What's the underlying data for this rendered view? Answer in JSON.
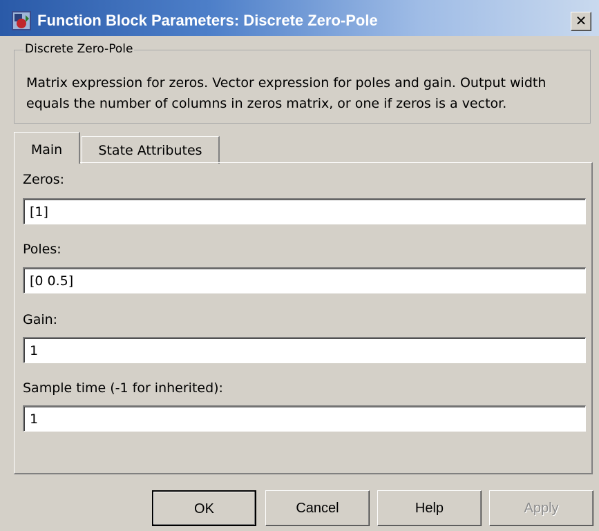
{
  "window": {
    "title": "Function Block Parameters: Discrete Zero-Pole",
    "icon": "simulink-block-icon",
    "close_glyph": "✕"
  },
  "group": {
    "legend": "Discrete Zero-Pole",
    "description": "Matrix expression for zeros.  Vector expression for poles and gain. Output width equals the number of columns in zeros matrix, or one if zeros is a vector."
  },
  "tabs": [
    {
      "label": "Main",
      "selected": true
    },
    {
      "label": "State Attributes",
      "selected": false
    }
  ],
  "fields": {
    "zeros": {
      "label": "Zeros:",
      "value": "[1]"
    },
    "poles": {
      "label": "Poles:",
      "value": "[0 0.5]"
    },
    "gain": {
      "label": "Gain:",
      "value": "1"
    },
    "sample_time": {
      "label": "Sample time (-1 for inherited):",
      "value": "1"
    }
  },
  "buttons": {
    "ok": "OK",
    "cancel": "Cancel",
    "help": "Help",
    "apply": "Apply"
  },
  "colors": {
    "titlebar_start": "#2a5aa8",
    "titlebar_end": "#c9d9ee",
    "dialog_face": "#d4d0c8",
    "disabled_text": "#8c8c8c"
  }
}
